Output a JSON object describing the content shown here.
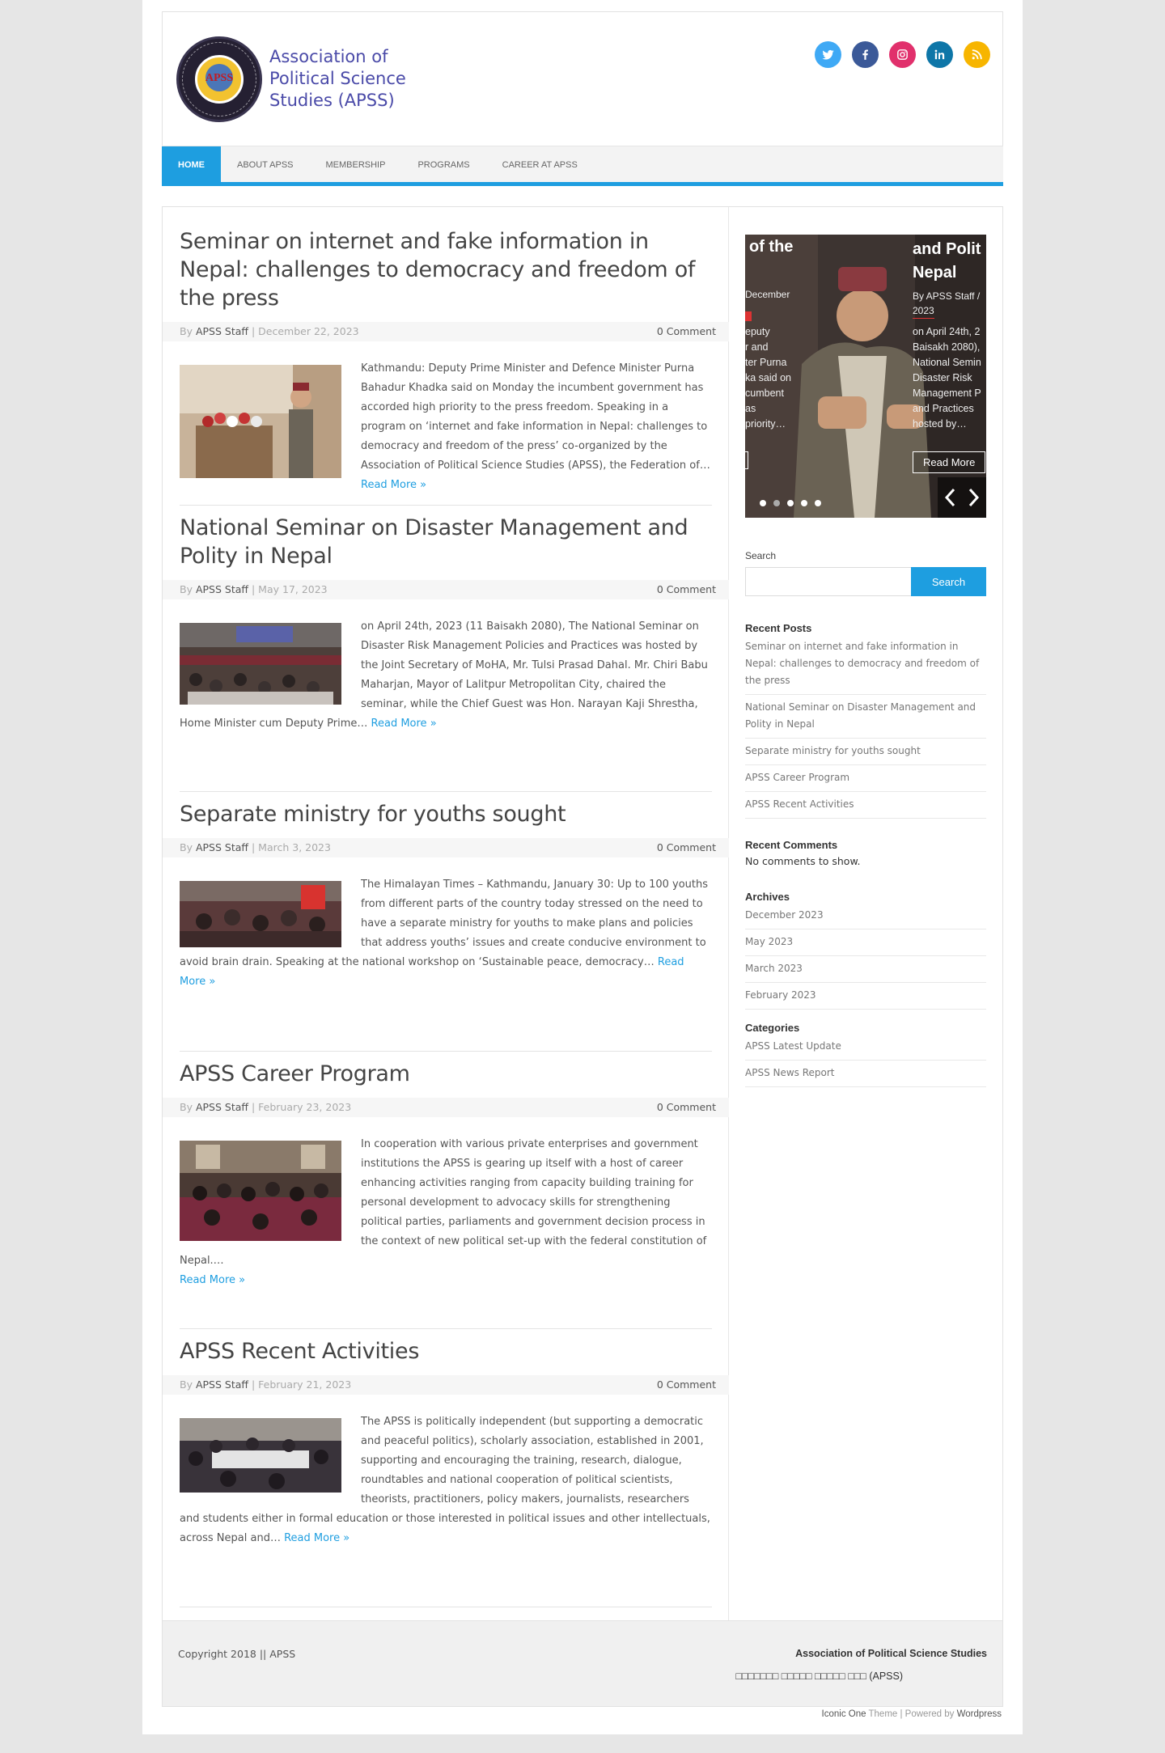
{
  "header": {
    "logo_line1": "Association of",
    "logo_line2": "Political Science",
    "logo_line3": "Studies (APSS)",
    "logo_badge": "APSS",
    "social": [
      {
        "name": "twitter-icon",
        "color": "#3fa9f5"
      },
      {
        "name": "facebook-icon",
        "color": "#3b5998"
      },
      {
        "name": "instagram-icon",
        "color": "#e1306c"
      },
      {
        "name": "linkedin-icon",
        "color": "#0e76a8"
      },
      {
        "name": "rss-icon",
        "color": "#f7b500"
      }
    ]
  },
  "nav": {
    "items": [
      {
        "label": "HOME",
        "active": true
      },
      {
        "label": "ABOUT APSS"
      },
      {
        "label": "MEMBERSHIP"
      },
      {
        "label": "PROGRAMS"
      },
      {
        "label": "CAREER AT APSS"
      }
    ]
  },
  "colors": {
    "accent": "#1e9ee0"
  },
  "posts": [
    {
      "title": "Seminar on internet and fake information in Nepal: challenges to democracy and freedom of the press",
      "by": "By ",
      "author": "APSS Staff",
      "date": " | December 22, 2023",
      "comments": "0 Comment",
      "excerpt": "Kathmandu: Deputy Prime Minister and Defence Minister Purna Bahadur Khadka said on Monday the incumbent government has accorded high priority to the press freedom. Speaking in a program on ‘internet and fake information in Nepal: challenges to democracy and freedom of the press’ co-organized by the Association of Political Science Studies (APSS), the Federation of…",
      "read_more": "Read More »"
    },
    {
      "title": "National Seminar on Disaster Management and Polity in Nepal",
      "by": "By ",
      "author": "APSS Staff",
      "date": " | May 17, 2023",
      "comments": "0 Comment",
      "excerpt": "on April 24th, 2023 (11 Baisakh 2080), The National Seminar on Disaster Risk Management Policies and Practices was hosted by the Joint Secretary of MoHA, Mr. Tulsi Prasad Dahal. Mr. Chiri Babu Maharjan, Mayor of Lalitpur Metropolitan City, chaired the seminar, while the Chief Guest was Hon. Narayan Kaji Shrestha, Home Minister cum Deputy Prime…",
      "read_more": "Read More »"
    },
    {
      "title": "Separate ministry for youths sought",
      "by": "By ",
      "author": "APSS Staff",
      "date": " | March 3, 2023",
      "comments": "0 Comment",
      "excerpt": "The Himalayan Times – Kathmandu, January 30: Up to 100 youths from different parts of the country today stressed on the need to have a separate ministry for youths to make plans and policies that address youths’ issues and create conducive environment to avoid brain drain. Speaking at the national workshop on ‘Sustainable peace, democracy…",
      "read_more": "Read More »"
    },
    {
      "title": "APSS Career Program",
      "by": "By ",
      "author": "APSS Staff",
      "date": " | February 23, 2023",
      "comments": "0 Comment",
      "excerpt": "In cooperation with various private enterprises and government institutions the APSS is gearing up itself with a host of career enhancing activities ranging from capacity building training for personal development to advocacy skills for strengthening political parties, parliaments and government decision process in the context of new political set-up with the federal constitution of Nepal.…",
      "read_more": "Read More »"
    },
    {
      "title": "APSS Recent Activities",
      "by": "By ",
      "author": "APSS Staff",
      "date": " | February 21, 2023",
      "comments": "0 Comment",
      "excerpt": "The APSS is politically independent (but supporting a democratic and peaceful politics), scholarly association, established in 2001, supporting and encouraging the training, research, dialogue, roundtables and national cooperation of political scientists, theorists, practitioners, policy makers, journalists, researchers and students either in formal education or those interested in political issues and other intellectuals, across Nepal and…",
      "read_more": "Read More »"
    }
  ],
  "slider": {
    "left_title": "of the",
    "left_meta": "December",
    "left_lines": [
      "eputy",
      "r and",
      "ter Purna",
      "ka said on",
      "cumbent",
      "as",
      "priority…"
    ],
    "right_title_1": "and Polit",
    "right_title_2": "Nepal",
    "right_meta_1": "By APSS Staff /",
    "right_meta_2": "2023",
    "right_lines": [
      "on April 24th, 2",
      "Baisakh 2080),",
      "National Semin",
      "Disaster Risk",
      "Management P",
      "and Practices",
      "hosted by…"
    ],
    "read_more": "Read More",
    "dots": 5
  },
  "sidebar": {
    "search_label": "Search",
    "search_button": "Search",
    "recent_posts_title": "Recent Posts",
    "recent_posts": [
      "Seminar on internet and fake information in Nepal: challenges to democracy and freedom of the press",
      "National Seminar on Disaster Management and Polity in Nepal",
      "Separate ministry for youths sought",
      "APSS Career Program",
      "APSS Recent Activities"
    ],
    "recent_comments_title": "Recent Comments",
    "recent_comments_empty": "No comments to show.",
    "archives_title": "Archives",
    "archives": [
      "December 2023",
      "May 2023",
      "March 2023",
      "February 2023"
    ],
    "categories_title": "Categories",
    "categories": [
      "APSS Latest Update",
      "APSS News Report"
    ]
  },
  "footer": {
    "copyright": "Copyright 2018 || APSS",
    "org_name": "Association of Political Science Studies",
    "org_sub": "□□□□□□□ □□□□□ □□□□□ □□□ (APSS)",
    "credit_theme": "Iconic One",
    "credit_theme_suffix": " Theme",
    "credit_sep": " | Powered by ",
    "credit_wp": "Wordpress"
  }
}
